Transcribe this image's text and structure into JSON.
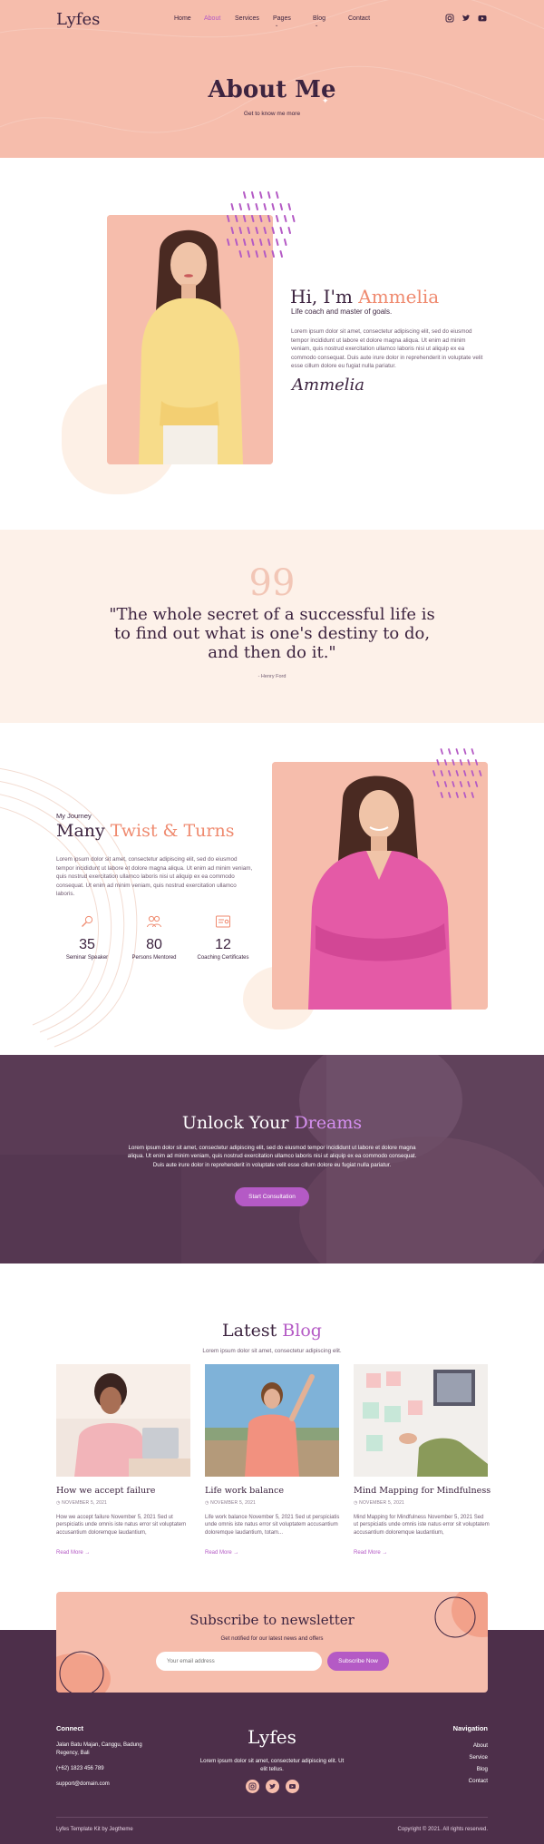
{
  "header": {
    "logo": "Lyfes",
    "nav": [
      {
        "label": "Home"
      },
      {
        "label": "About"
      },
      {
        "label": "Services"
      },
      {
        "label": "Pages"
      },
      {
        "label": "Blog"
      },
      {
        "label": "Contact"
      }
    ],
    "social_icons": [
      "instagram-icon",
      "twitter-icon",
      "youtube-icon"
    ]
  },
  "hero": {
    "title": "About Me",
    "subtitle": "Get to know me more"
  },
  "about": {
    "greeting": "Hi, I'm ",
    "name": "Ammelia",
    "tagline": "Life coach and master of goals.",
    "paragraph": "Lorem ipsum dolor sit amet, consectetur adipiscing elit, sed do eiusmod tempor incididunt ut labore et dolore magna aliqua. Ut enim ad minim veniam, quis nostrud exercitation ullamco laboris nisi ut aliquip ex ea commodo consequat. Duis aute irure dolor in reprehenderit in voluptate velit esse cillum dolore eu fugiat nulla pariatur.",
    "signature": "Ammelia"
  },
  "quote": {
    "mark": "99",
    "text": "\"The whole secret of a successful life is to find out what is one's destiny to do, and then do it.\"",
    "author": "- Henry Ford"
  },
  "journey": {
    "eyebrow": "My Journey",
    "title_plain": "Many ",
    "title_accent": "Twist & Turns",
    "paragraph": "Lorem ipsum dolor sit amet, consectetur adipiscing elit, sed do eiusmod tempor incididunt ut labore et dolore magna aliqua. Ut enim ad minim veniam, quis nostrud exercitation ullamco laboris nisi ut aliquip ex ea commodo consequat. Ut enim ad minim veniam, quis nostrud exercitation ullamco laboris.",
    "stats": [
      {
        "icon": "microphone-icon",
        "value": "35",
        "label": "Seminar Speaker"
      },
      {
        "icon": "people-icon",
        "value": "80",
        "label": "Persons Mentored"
      },
      {
        "icon": "certificate-icon",
        "value": "12",
        "label": "Coaching Certificates"
      }
    ]
  },
  "dreams": {
    "title_plain": "Unlock Your ",
    "title_accent": "Dreams",
    "paragraph": "Lorem ipsum dolor sit amet, consectetur adipiscing elit, sed do eiusmod tempor incididunt ut labore et dolore magna aliqua. Ut enim ad minim veniam, quis nostrud exercitation ullamco laboris nisi ut aliquip ex ea commodo consequat. Duis aute irure dolor in reprehenderit in voluptate velit esse cillum dolore eu fugiat nulla pariatur.",
    "button": "Start Consultation"
  },
  "blog": {
    "title_plain": "Latest ",
    "title_accent": "Blog",
    "subtitle": "Lorem ipsum dolor sit amet, consectetur adipiscing elit.",
    "posts": [
      {
        "title": "How we accept failure",
        "date": "NOVEMBER 5, 2021",
        "excerpt": "How we accept failure November 5, 2021 Sed ut perspiciatis unde omnis iste natus error sit voluptatem accusantium doloremque laudantium,",
        "more": "Read More"
      },
      {
        "title": "Life work balance",
        "date": "NOVEMBER 5, 2021",
        "excerpt": "Life work balance November 5, 2021 Sed ut perspiciatis unde omnis iste natus error sit voluptatem accusantium doloremque laudantium, totam...",
        "more": "Read More"
      },
      {
        "title": "Mind Mapping for Mindfulness",
        "date": "NOVEMBER 5, 2021",
        "excerpt": "Mind Mapping for Mindfulness November 5, 2021 Sed ut perspiciatis unde omnis iste natus error sit voluptatem accusantium doloremque laudantium,",
        "more": "Read More"
      }
    ]
  },
  "newsletter": {
    "title": "Subscribe to newsletter",
    "subtitle": "Get notified for our latest news and offers",
    "placeholder": "Your email address",
    "button": "Subscribe Now"
  },
  "footer": {
    "connect_heading": "Connect",
    "address": "Jalan Batu Majan, Canggu, Badung Regency, Bali",
    "phone": "(+62) 1823 456 789",
    "email": "support@domain.com",
    "logo": "Lyfes",
    "about_text": "Lorem ipsum dolor sit amet, consectetur adipiscing elit. Ut elit tellus.",
    "navigation_heading": "Navigation",
    "links": [
      "About",
      "Service",
      "Blog",
      "Contact"
    ],
    "credit": "Lyfes Template Kit by Jegtheme",
    "copyright": "Copyright © 2021. All rights reserved."
  },
  "colors": {
    "peach": "#f6bdac",
    "plum": "#4d2f4a",
    "purple_accent": "#b45ac5",
    "coral_accent": "#ef8a6f",
    "cream": "#fdf1e9"
  }
}
